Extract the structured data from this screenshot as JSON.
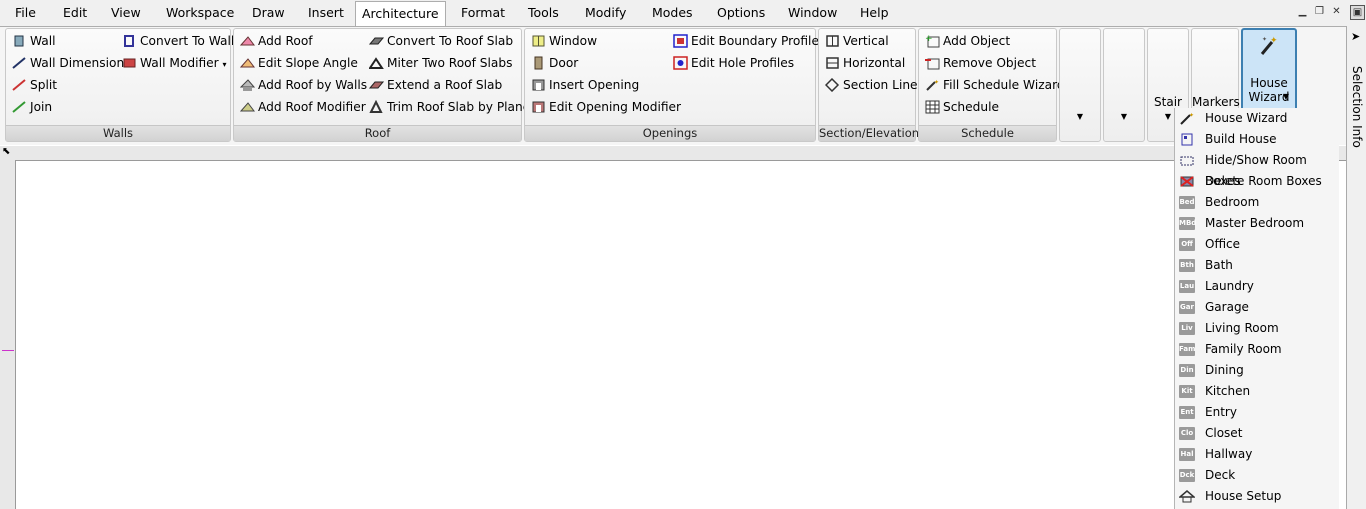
{
  "menubar": {
    "items": [
      "File",
      "Edit",
      "View",
      "Workspace",
      "Draw",
      "Insert",
      "Architecture",
      "Format",
      "Tools",
      "Modify",
      "Modes",
      "Options",
      "Window",
      "Help"
    ],
    "active": "Architecture"
  },
  "ribbon": {
    "walls": {
      "title": "Walls",
      "wall": "Wall",
      "wall_dimension": "Wall Dimension",
      "split": "Split",
      "join": "Join",
      "convert_to_wall": "Convert To Wall",
      "wall_modifier": "Wall Modifier"
    },
    "roof": {
      "title": "Roof",
      "add_roof": "Add Roof",
      "edit_slope_angle": "Edit Slope Angle",
      "add_roof_by_walls": "Add Roof by Walls",
      "add_roof_modifier": "Add Roof Modifier",
      "convert_to_roof_slab": "Convert To Roof Slab",
      "miter_two_roof_slabs": "Miter Two Roof Slabs",
      "extend_a_roof_slab": "Extend a Roof Slab",
      "trim_roof_slab_by_plane": "Trim Roof Slab by Plane"
    },
    "openings": {
      "title": "Openings",
      "window": "Window",
      "door": "Door",
      "insert_opening": "Insert Opening",
      "edit_opening_modifier": "Edit Opening Modifier",
      "edit_boundary_profiles": "Edit Boundary Profiles",
      "edit_hole_profiles": "Edit Hole Profiles"
    },
    "section": {
      "title": "Section/Elevation",
      "vertical": "Vertical",
      "horizontal": "Horizontal",
      "section_line": "Section Line"
    },
    "schedule": {
      "title": "Schedule",
      "add_object": "Add Object",
      "remove_object": "Remove Object",
      "fill_schedule_wizard": "Fill Schedule Wizard",
      "schedule": "Schedule"
    },
    "stair": "Stair",
    "markers": "Markers",
    "house_wizard": "House Wizard"
  },
  "dropdown": {
    "items": [
      {
        "label": "House Wizard",
        "icon": "wand-icon"
      },
      {
        "label": "Build House",
        "icon": "build-house-icon"
      },
      {
        "label": "Hide/Show Room Boxes",
        "icon": "room-boxes-icon"
      },
      {
        "label": "Delete Room Boxes",
        "icon": "delete-room-boxes-icon"
      },
      {
        "label": "Bedroom",
        "icon": "bedroom-icon",
        "abbr": "Bed"
      },
      {
        "label": "Master Bedroom",
        "icon": "master-bedroom-icon",
        "abbr": "MBd"
      },
      {
        "label": "Office",
        "icon": "office-icon",
        "abbr": "Off"
      },
      {
        "label": "Bath",
        "icon": "bath-icon",
        "abbr": "Bth"
      },
      {
        "label": "Laundry",
        "icon": "laundry-icon",
        "abbr": "Lau"
      },
      {
        "label": "Garage",
        "icon": "garage-icon",
        "abbr": "Gar"
      },
      {
        "label": "Living Room",
        "icon": "living-room-icon",
        "abbr": "Liv"
      },
      {
        "label": "Family Room",
        "icon": "family-room-icon",
        "abbr": "Fam"
      },
      {
        "label": "Dining",
        "icon": "dining-icon",
        "abbr": "Din"
      },
      {
        "label": "Kitchen",
        "icon": "kitchen-icon",
        "abbr": "Kit"
      },
      {
        "label": "Entry",
        "icon": "entry-icon",
        "abbr": "Ent"
      },
      {
        "label": "Closet",
        "icon": "closet-icon",
        "abbr": "Clo"
      },
      {
        "label": "Hallway",
        "icon": "hallway-icon",
        "abbr": "Hal"
      },
      {
        "label": "Deck",
        "icon": "deck-icon",
        "abbr": "Dck"
      },
      {
        "label": "House Setup",
        "icon": "house-setup-icon"
      }
    ]
  },
  "right_palette": {
    "title": "Selection Info"
  },
  "colors": {
    "accent": "#cce4f7",
    "active_border": "#3c7fb1"
  }
}
